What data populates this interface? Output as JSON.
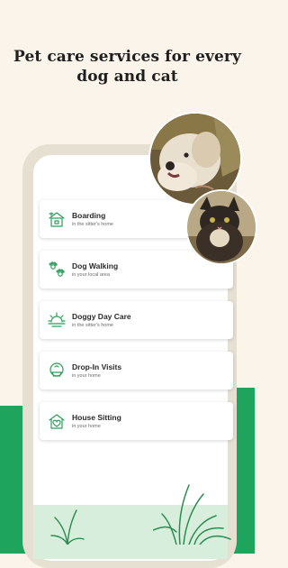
{
  "headline": "Pet care services for every dog and cat",
  "services": [
    {
      "title": "Boarding",
      "subtitle": "in the sitter's home",
      "icon": "boarding-house-icon"
    },
    {
      "title": "Dog Walking",
      "subtitle": "in your local area",
      "icon": "paw-prints-icon"
    },
    {
      "title": "Doggy Day Care",
      "subtitle": "in the sitter's home",
      "icon": "sun-house-icon"
    },
    {
      "title": "Drop-In Visits",
      "subtitle": "in your home",
      "icon": "drop-in-bowl-icon"
    },
    {
      "title": "House Sitting",
      "subtitle": "in your home",
      "icon": "house-heart-icon"
    }
  ],
  "images": {
    "dog": "dog-photo",
    "cat": "cat-photo"
  },
  "colors": {
    "background": "#fbf4ea",
    "accent_green": "#1ea45c",
    "icon_green": "#2c9e5a",
    "phone_frame": "#e5e0d2"
  }
}
